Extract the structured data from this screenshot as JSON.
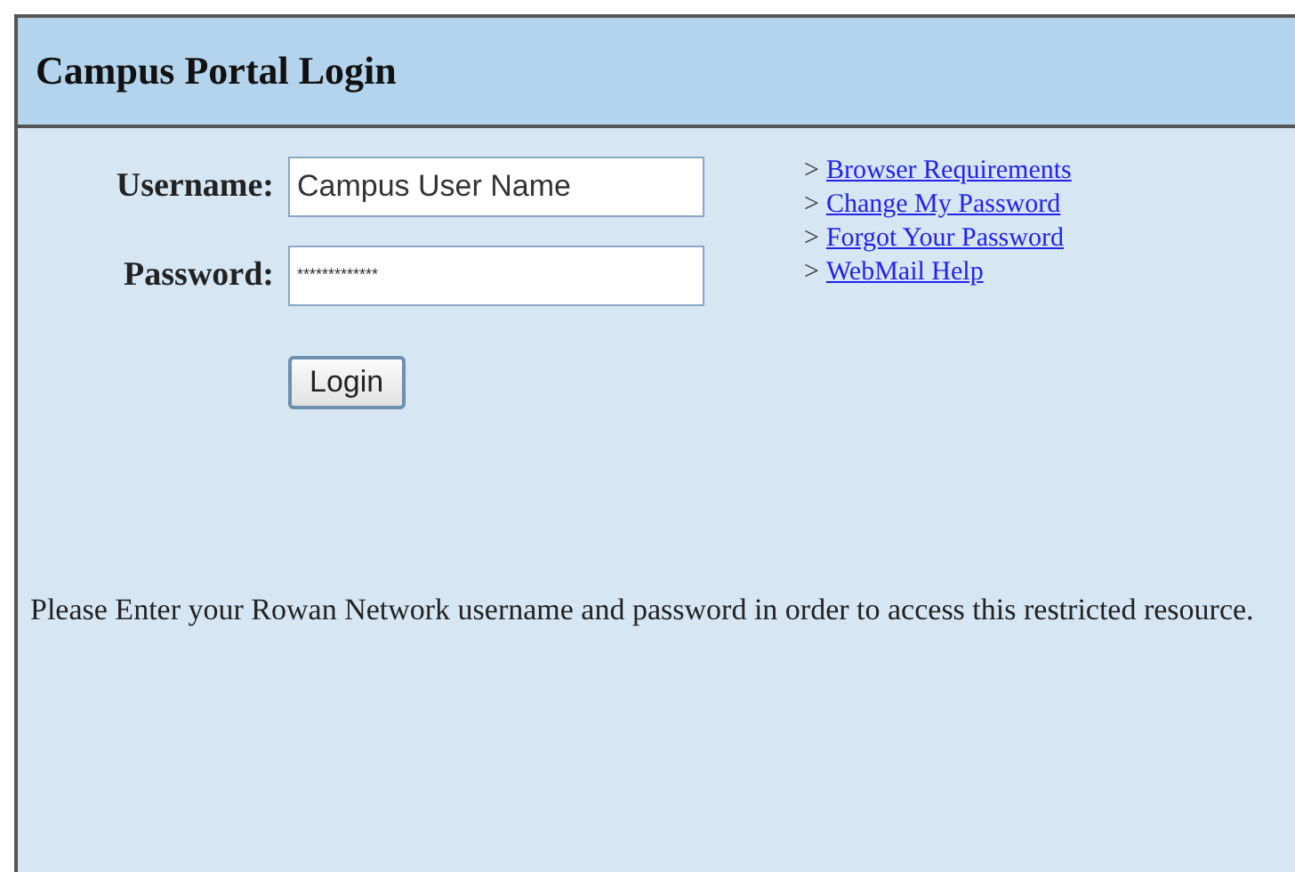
{
  "panel": {
    "title": "Campus Portal Login"
  },
  "form": {
    "fields": [
      {
        "label": "Username:",
        "value": "Campus User Name",
        "kind": "text"
      },
      {
        "label": "Password:",
        "value": "*************",
        "kind": "masked"
      }
    ],
    "button": "Login"
  },
  "links": [
    {
      "marker": ">",
      "label": "Browser Requirements"
    },
    {
      "marker": ">",
      "label": "Change My Password"
    },
    {
      "marker": ">",
      "label": "Forgot Your Password"
    },
    {
      "marker": ">",
      "label": "WebMail Help"
    }
  ],
  "message": "Please Enter your Rowan Network username and password in order to access this restricted resource."
}
